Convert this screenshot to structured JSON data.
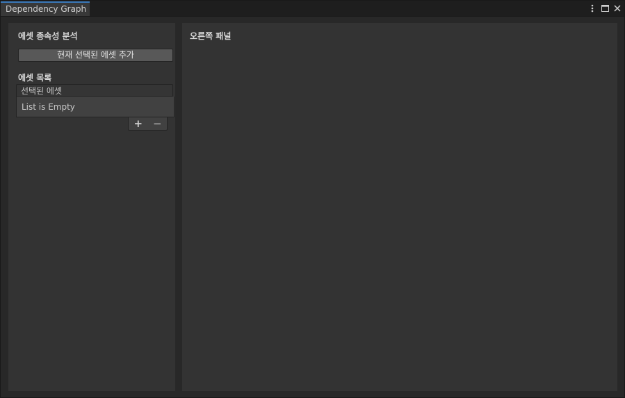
{
  "window": {
    "tab_title": "Dependency Graph",
    "controls": [
      {
        "name": "more-options-icon",
        "glyph": "⋮"
      },
      {
        "name": "maximize-icon",
        "glyph": "□"
      },
      {
        "name": "close-icon",
        "glyph": "✕"
      }
    ]
  },
  "left_panel": {
    "title": "에셋 종속성 분석",
    "add_button_label": "현재 선택된 에셋 추가",
    "list_title": "에셋 목록",
    "list": {
      "header": "선택된 에셋",
      "empty_text": "List is Empty",
      "add_glyph": "+",
      "remove_glyph": "−"
    }
  },
  "right_panel": {
    "title": "오른쪽 패널"
  },
  "colors": {
    "tab_accent": "#3a79bb",
    "panel_bg": "#333333",
    "window_bg": "#282828"
  }
}
